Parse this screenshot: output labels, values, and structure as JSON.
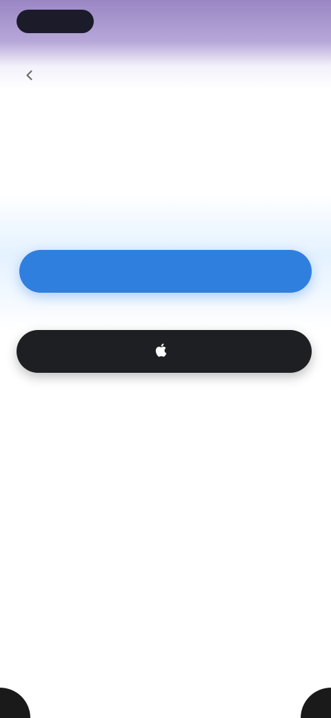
{
  "status_bar": {
    "time": "",
    "pill_color": "#1b1b2a",
    "background_color": "#9a86c4"
  },
  "nav": {
    "back_icon": "chevron-left-icon",
    "title": ""
  },
  "content": {
    "headline": "",
    "primary_button_label": "",
    "primary_button_color": "#2f7fdf",
    "separator_text": "",
    "apple_icon": "apple-logo-icon",
    "apple_button_label": "",
    "apple_button_color": "#1e1f22",
    "secondary_link_label": "",
    "legal_text": ""
  }
}
